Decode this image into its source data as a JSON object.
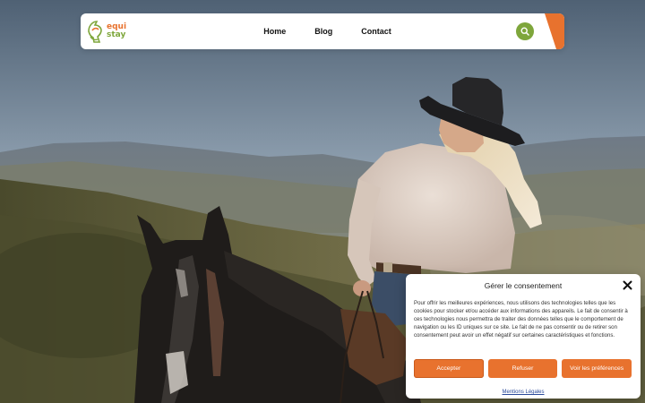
{
  "header": {
    "logo": {
      "line1": "equi",
      "line2": "stay"
    },
    "nav": [
      {
        "label": "Home"
      },
      {
        "label": "Blog"
      },
      {
        "label": "Contact"
      }
    ],
    "search_icon": "search-icon",
    "colors": {
      "accent_orange": "#e8722e",
      "accent_green": "#7ea63b"
    }
  },
  "consent": {
    "title": "Gérer le consentement",
    "body": "Pour offrir les meilleures expériences, nous utilisons des technologies telles que les cookies pour stocker et/ou accéder aux informations des appareils. Le fait de consentir à ces technologies nous permettra de traiter des données telles que le comportement de navigation ou les ID uniques sur ce site. Le fait de ne pas consentir ou de retirer son consentement peut avoir un effet négatif sur certaines caractéristiques et fonctions.",
    "buttons": {
      "accept": "Accepter",
      "refuse": "Refuser",
      "preferences": "Voir les préférences"
    },
    "legal_link": "Mentions Légales",
    "close_icon": "close-icon"
  }
}
